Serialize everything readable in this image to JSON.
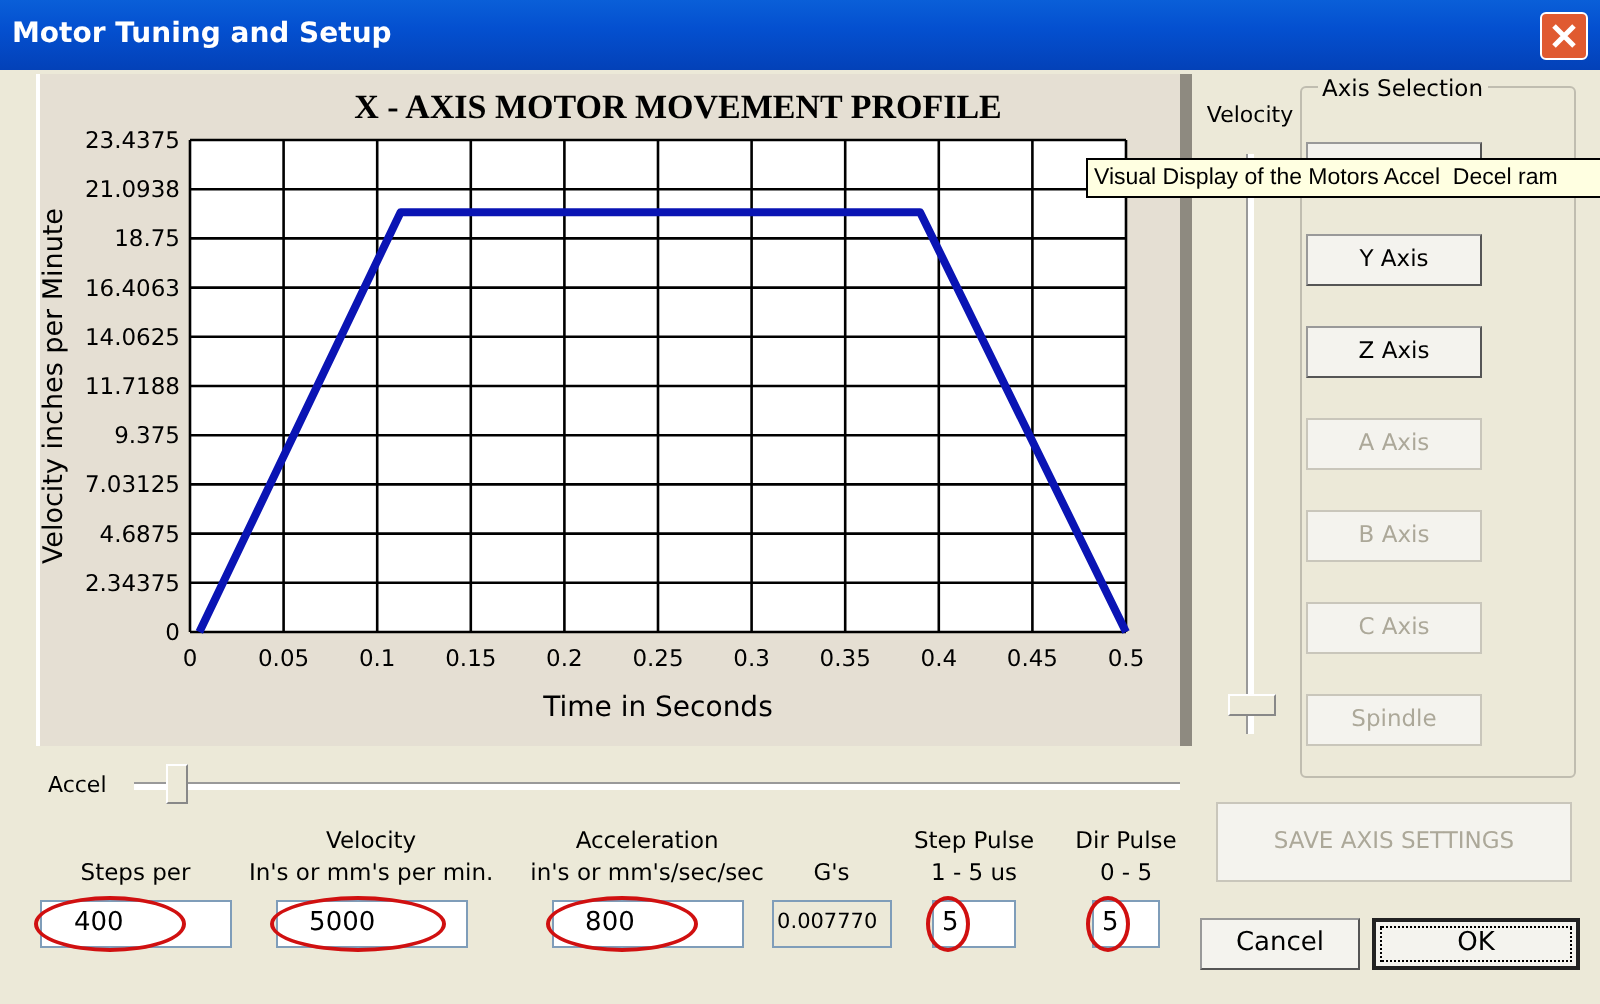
{
  "window": {
    "title": "Motor Tuning and Setup"
  },
  "chart": {
    "chart_data": {
      "type": "line",
      "title": "X - AXIS MOTOR MOVEMENT PROFILE",
      "xlabel": "Time in Seconds",
      "ylabel": "Velocity inches per Minute",
      "x": [
        0.005,
        0.1125,
        0.39,
        0.5
      ],
      "series": [
        {
          "color": "#0a14b4",
          "values": [
            0,
            20,
            20,
            0
          ]
        }
      ],
      "grid": true,
      "xlim": [
        0,
        0.5
      ],
      "ylim": [
        0,
        23.4375
      ],
      "xticks": [
        0,
        0.05,
        0.1,
        0.15,
        0.2,
        0.25,
        0.3,
        0.35,
        0.4,
        0.45,
        0.5
      ],
      "yticks": [
        0,
        2.34375,
        4.6875,
        7.03125,
        9.375,
        11.7188,
        14.0625,
        16.4063,
        18.75,
        21.0938,
        23.4375
      ]
    }
  },
  "velocity_slider": {
    "label": "Velocity",
    "level": 0.03
  },
  "axis_selection": {
    "title": "Axis Selection",
    "buttons": [
      {
        "disabled": false
      },
      {
        "label": "Y Axis",
        "disabled": false
      },
      {
        "label": "Z Axis",
        "disabled": false
      },
      {
        "label": "A Axis",
        "disabled": true
      },
      {
        "label": "B Axis",
        "disabled": true
      },
      {
        "label": "C Axis",
        "disabled": true
      },
      {
        "label": "Spindle",
        "disabled": true
      }
    ]
  },
  "tooltip": {
    "text": "Visual Display of the Motors Accel  Decel ram"
  },
  "accel_slider": {
    "label": "Accel",
    "level": 0.03
  },
  "fields": [
    {
      "label": [
        "Steps per"
      ],
      "value": "400",
      "readonly": false,
      "circled": true
    },
    {
      "label": [
        "Velocity",
        "In's or mm's per min."
      ],
      "value": "5000",
      "readonly": false,
      "circled": true
    },
    {
      "label": [
        "Acceleration",
        "in's or mm's/sec/sec"
      ],
      "value": "800",
      "readonly": false,
      "circled": true
    },
    {
      "label": [
        "G's"
      ],
      "value": "0.007770",
      "readonly": true,
      "circled": false
    },
    {
      "label": [
        "Step Pulse",
        "1 - 5 us"
      ],
      "value": "5",
      "readonly": false,
      "circled": true
    },
    {
      "label": [
        "Dir Pulse",
        "0 - 5"
      ],
      "value": "5",
      "readonly": false,
      "circled": true
    }
  ],
  "save_button": {
    "label": "SAVE AXIS SETTINGS",
    "disabled": true
  },
  "buttons": [
    {
      "label": "Cancel",
      "default": false
    },
    {
      "label": "OK",
      "default": true
    }
  ]
}
